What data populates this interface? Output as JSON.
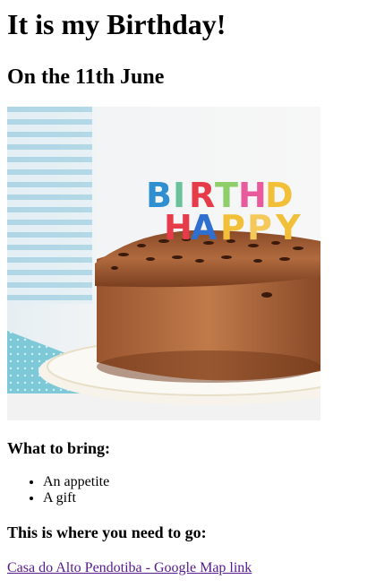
{
  "page": {
    "title": "It is my Birthday!",
    "subtitle": "On the 11th June",
    "image": {
      "icon": "birthday-cake-image",
      "candle_letters_row1": [
        "B",
        "I",
        "R",
        "T",
        "H",
        "D"
      ],
      "candle_letters_row2": [
        "H",
        "A",
        "P",
        "P"
      ]
    },
    "bring_heading": "What to bring:",
    "bring_items": [
      "An appetite",
      "A gift"
    ],
    "where_heading": "This is where you need to go:",
    "map_link_text": "Casa do Alto Pendotiba - Google Map link"
  },
  "colors": {
    "link_visited": "#551a8b",
    "text": "#000000"
  }
}
